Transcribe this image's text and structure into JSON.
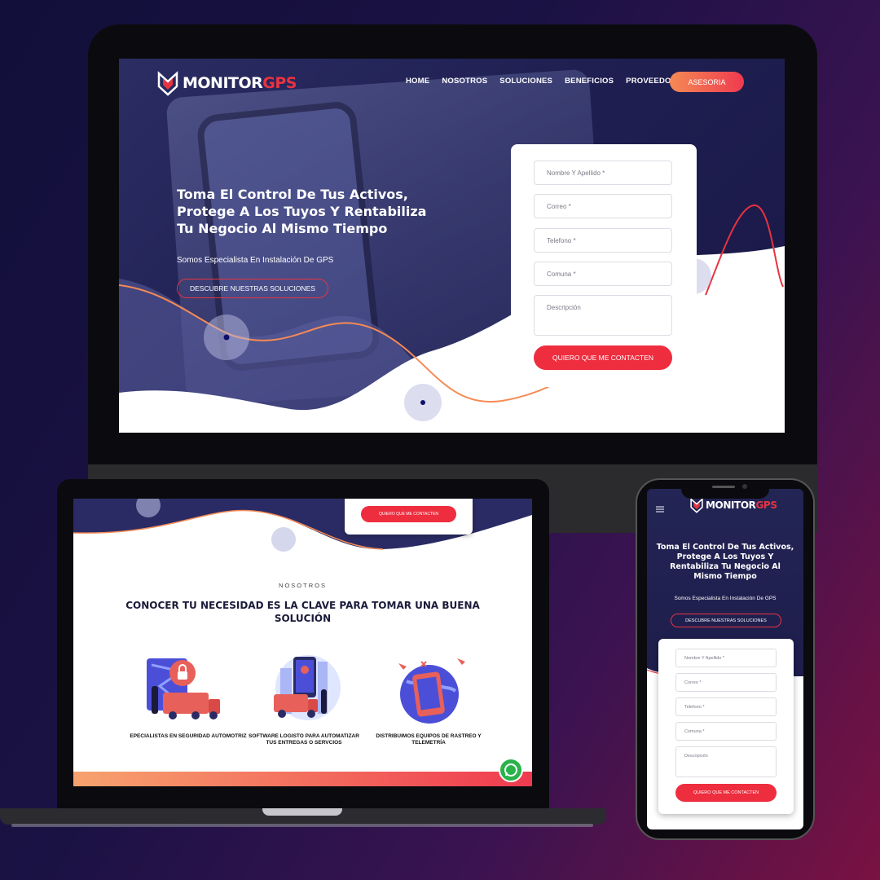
{
  "brand": {
    "logo_main": "MONITOR",
    "logo_accent": "GPS"
  },
  "nav": {
    "items": [
      "HOME",
      "NOSOTROS",
      "SOLUCIONES",
      "BENEFICIOS",
      "PROVEEDORES"
    ],
    "cta": "ASESORIA"
  },
  "hero": {
    "title": "Toma El Control De Tus Activos, Protege A Los Tuyos Y Rentabiliza Tu Negocio Al Mismo Tiempo",
    "subtitle": "Somos Especialista En Instalación De GPS",
    "button": "DESCUBRE NUESTRAS SOLUCIONES"
  },
  "form": {
    "name_placeholder": "Nombre Y Apellido *",
    "email_placeholder": "Correo *",
    "phone_placeholder": "Telefono *",
    "commune_placeholder": "Comuna *",
    "description_placeholder": "Descripción",
    "submit": "QUIERO QUE ME CONTACTEN"
  },
  "about": {
    "eyebrow": "NOSOTROS",
    "heading": "CONOCER TU NECESIDAD ES LA CLAVE PARA TOMAR UNA BUENA SOLUCIÓN",
    "services": [
      {
        "caption": "EPECIALISTAS EN SEGURIDAD AUTOMOTRIZ",
        "icon": "truck-lock-icon"
      },
      {
        "caption": "SOFTWARE LOGISTO PARA AUTOMATIZAR TUS ENTREGAS O SERVCIOS",
        "icon": "city-delivery-icon"
      },
      {
        "caption": "DISTRIBUIMOS EQUIPOS DE RASTREO Y TELEMETRÍA",
        "icon": "globe-tracking-icon"
      }
    ]
  },
  "colors": {
    "accent": "#ee2d3e",
    "accent_gradient_start": "#f58a55",
    "navy": "#1e1d4c",
    "whatsapp": "#2bb34b"
  }
}
